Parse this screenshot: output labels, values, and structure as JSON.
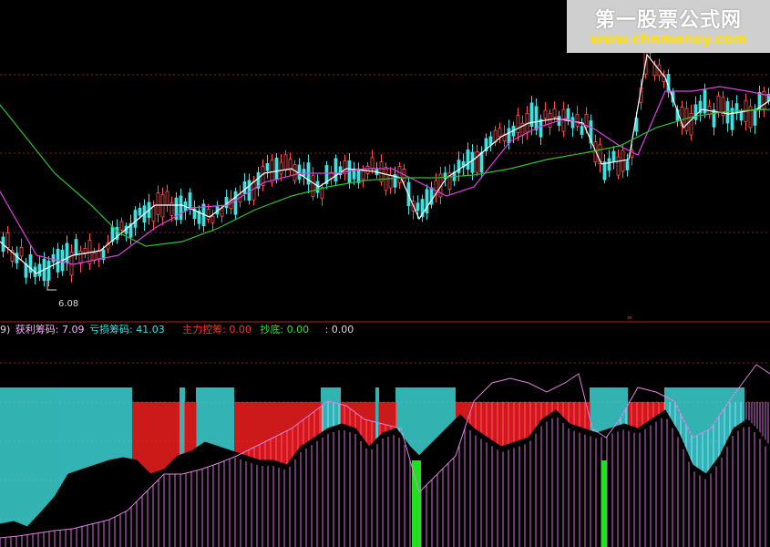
{
  "chart_data": [
    {
      "type": "candlestick",
      "title": "",
      "annotations": [
        {
          "label": "6.08"
        }
      ],
      "series": [
        {
          "name": "",
          "color": "#ffffff",
          "x": [
            0,
            40,
            80,
            110,
            140,
            170,
            200,
            230,
            260,
            290,
            320,
            350,
            380,
            410,
            440,
            460,
            490,
            520,
            550,
            580,
            610,
            640,
            660,
            690,
            710,
            730,
            750,
            770,
            800,
            830,
            845
          ],
          "y": [
            265,
            300,
            280,
            275,
            250,
            225,
            225,
            238,
            215,
            190,
            185,
            205,
            185,
            188,
            195,
            240,
            195,
            175,
            150,
            135,
            130,
            135,
            180,
            175,
            60,
            85,
            140,
            120,
            125,
            120,
            110
          ]
        },
        {
          "name": "",
          "color": "#e040e0",
          "x": [
            0,
            40,
            80,
            130,
            170,
            210,
            250,
            290,
            330,
            370,
            400,
            430,
            460,
            490,
            520,
            560,
            590,
            620,
            650,
            680,
            700,
            730,
            760,
            790,
            820,
            845
          ],
          "y": [
            210,
            280,
            290,
            280,
            250,
            228,
            225,
            200,
            190,
            190,
            185,
            185,
            200,
            215,
            205,
            155,
            140,
            130,
            140,
            160,
            170,
            100,
            100,
            95,
            100,
            105
          ]
        },
        {
          "name": "",
          "color": "#30c030",
          "x": [
            0,
            60,
            100,
            130,
            160,
            200,
            240,
            280,
            320,
            360,
            400,
            440,
            480,
            520,
            560,
            600,
            640,
            680,
            720,
            760,
            800,
            845
          ],
          "y": [
            115,
            190,
            225,
            255,
            270,
            265,
            250,
            230,
            215,
            205,
            198,
            195,
            195,
            192,
            185,
            175,
            168,
            160,
            140,
            128,
            122,
            120
          ]
        }
      ]
    },
    {
      "type": "bar",
      "title": "",
      "legend": [
        {
          "label": "9)",
          "color": "#d8d8d8"
        },
        {
          "label": "获利筹码: 7.09",
          "color": "#ffb0ff"
        },
        {
          "label": "亏损筹码: 41.03",
          "color": "#40e0e0"
        },
        {
          "label": "主力控筹: 0.00",
          "color": "#ff3030"
        },
        {
          "label": "抄底: 0.00",
          "color": "#30e030"
        },
        {
          "label": ": 0.00",
          "color": "#d8d8d8"
        }
      ],
      "cyan_ranges": [
        [
          0,
          146
        ],
        [
          198,
          203
        ],
        [
          216,
          258
        ],
        [
          353,
          375
        ],
        [
          413,
          416
        ],
        [
          435,
          501
        ],
        [
          648,
          690
        ],
        [
          730,
          818
        ]
      ],
      "red_ranges": [
        [
          146,
          198
        ],
        [
          203,
          216
        ],
        [
          258,
          353
        ],
        [
          375,
          413
        ],
        [
          416,
          435
        ],
        [
          501,
          648
        ],
        [
          690,
          730
        ]
      ],
      "green_ranges": [
        [
          452,
          462
        ],
        [
          660,
          666
        ]
      ],
      "black_area": {
        "x": [
          0,
          15,
          30,
          45,
          60,
          75,
          90,
          105,
          120,
          135,
          150,
          165,
          180,
          195,
          210,
          225,
          240,
          255,
          270,
          285,
          300,
          315,
          330,
          345,
          360,
          375,
          390,
          405,
          420,
          435,
          450,
          460,
          475,
          490,
          505,
          520,
          535,
          550,
          565,
          580,
          595,
          610,
          625,
          640,
          655,
          670,
          685,
          700,
          715,
          730,
          745,
          760,
          775,
          790,
          805,
          820,
          830,
          845
        ],
        "y": [
          575,
          572,
          578,
          562,
          545,
          520,
          515,
          510,
          505,
          502,
          505,
          520,
          515,
          500,
          495,
          485,
          490,
          495,
          500,
          505,
          505,
          510,
          490,
          480,
          470,
          465,
          470,
          490,
          475,
          470,
          490,
          500,
          485,
          470,
          455,
          470,
          480,
          490,
          485,
          480,
          460,
          450,
          465,
          470,
          475,
          470,
          465,
          470,
          460,
          450,
          475,
          510,
          520,
          500,
          470,
          460,
          470,
          490
        ]
      },
      "pink_line": {
        "x": [
          0,
          20,
          40,
          60,
          80,
          100,
          120,
          140,
          160,
          180,
          200,
          220,
          240,
          260,
          280,
          300,
          320,
          340,
          360,
          380,
          400,
          420,
          440,
          460,
          480,
          500,
          520,
          540,
          560,
          580,
          600,
          620,
          635,
          650,
          665,
          680,
          700,
          720,
          740,
          760,
          780,
          800,
          815,
          830,
          845
        ],
        "y": [
          590,
          588,
          585,
          582,
          580,
          575,
          570,
          560,
          540,
          520,
          520,
          515,
          508,
          500,
          490,
          480,
          470,
          455,
          440,
          445,
          460,
          465,
          470,
          540,
          520,
          500,
          440,
          420,
          415,
          420,
          430,
          420,
          410,
          470,
          480,
          460,
          425,
          430,
          440,
          480,
          470,
          440,
          420,
          400,
          410
        ]
      }
    }
  ],
  "watermark": {
    "title": "第一股票公式网",
    "url": "www.chnmoney.com"
  }
}
